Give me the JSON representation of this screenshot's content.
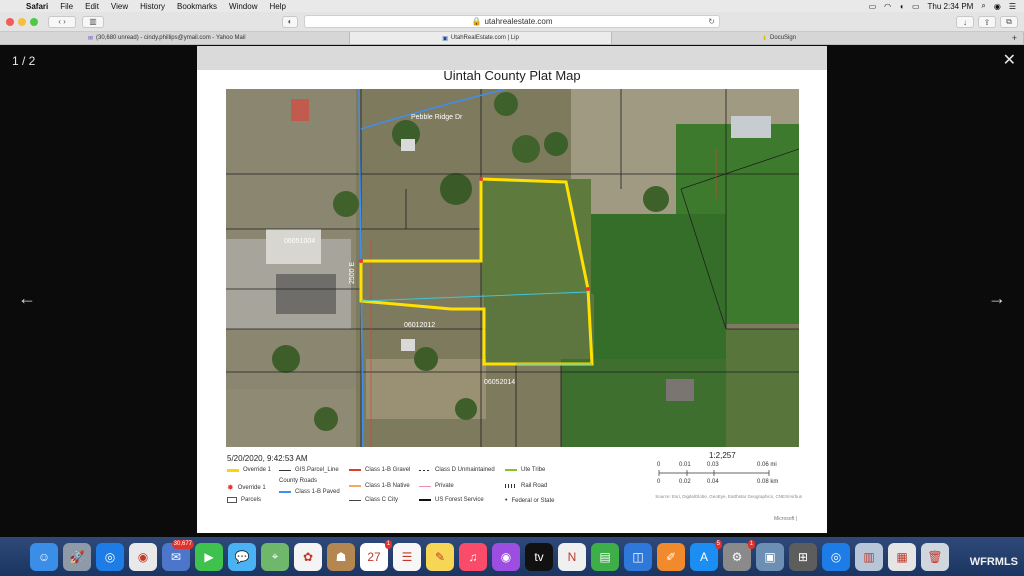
{
  "menubar": {
    "apple_icon": "apple-icon",
    "app_name": "Safari",
    "items": [
      "File",
      "Edit",
      "View",
      "History",
      "Bookmarks",
      "Window",
      "Help"
    ],
    "clock": "Thu 2:34 PM"
  },
  "browser": {
    "url": "utahrealestate.com",
    "tabs": [
      {
        "label": "(30,680 unread) - cindy.phillips@ymail.com - Yahoo Mail",
        "active": false
      },
      {
        "label": "UtahRealEstate.com | Lip",
        "active": true
      },
      {
        "label": "DocuSign",
        "active": false
      }
    ]
  },
  "lightbox": {
    "counter": "1 / 2",
    "close_icon": "close-icon",
    "prev_icon": "arrow-left-icon",
    "next_icon": "arrow-right-icon"
  },
  "plat": {
    "title": "Uintah County Plat Map",
    "timestamp": "5/20/2020, 9:42:53 AM",
    "scale_ratio": "1:2,257",
    "scale_mi": [
      "0",
      "0.01",
      "0.03",
      "0.06 mi"
    ],
    "scale_km": [
      "0",
      "0.02",
      "0.04",
      "0.08 km"
    ],
    "source": "Source: Esri, DigitalGlobe, GeoEye, Earthstar Geographics, CNES/Airbus",
    "microsoft": "Microsoft |",
    "map_labels": {
      "pebble_ridge": "Pebble Ridge Dr",
      "street_2500": "2500 E",
      "parcel_a": "06051004",
      "parcel_b": "06012012",
      "parcel_c": "06052014"
    },
    "legend": [
      {
        "label": "Override 1",
        "kind": "yellow-line",
        "color": "#ffd500"
      },
      {
        "label": "Override 1",
        "kind": "red-star",
        "color": "#e33"
      },
      {
        "label": "Parcels",
        "kind": "box",
        "color": "#555"
      },
      {
        "label": "GIS.Parcel_Line",
        "kind": "line",
        "color": "#333"
      },
      {
        "label": "County Roads",
        "kind": "none",
        "color": "#333"
      },
      {
        "label": "Class 1-B Paved",
        "kind": "line",
        "color": "#3f8ef0"
      },
      {
        "label": "Class 1-B Gravel",
        "kind": "line",
        "color": "#e23c2c"
      },
      {
        "label": "Class 1-B Native",
        "kind": "line",
        "color": "#f2a86a"
      },
      {
        "label": "Class C City",
        "kind": "line",
        "color": "#444"
      },
      {
        "label": "Class D Unmaintained",
        "kind": "dash",
        "color": "#333"
      },
      {
        "label": "Private",
        "kind": "line",
        "color": "#f08fb0"
      },
      {
        "label": "US Forest Service",
        "kind": "line",
        "color": "#111"
      },
      {
        "label": "Ute Tribe",
        "kind": "line",
        "color": "#7ec23c"
      },
      {
        "label": "Rail Road",
        "kind": "rail",
        "color": "#333"
      },
      {
        "label": "Federal or State",
        "kind": "dot",
        "color": "#333"
      }
    ]
  },
  "dock": {
    "apps": [
      {
        "name": "finder-icon",
        "color": "#3a8ee8",
        "glyph": "☺",
        "badge": ""
      },
      {
        "name": "launchpad-icon",
        "color": "#8e9aa8",
        "glyph": "🚀",
        "badge": ""
      },
      {
        "name": "safari-icon",
        "color": "#1e7ce6",
        "glyph": "◎",
        "badge": ""
      },
      {
        "name": "chrome-icon",
        "color": "#e9e9e9",
        "glyph": "◉",
        "badge": ""
      },
      {
        "name": "mail-icon",
        "color": "#4b76c9",
        "glyph": "✉",
        "badge": "30,677"
      },
      {
        "name": "facetime-icon",
        "color": "#3ec24d",
        "glyph": "▶",
        "badge": ""
      },
      {
        "name": "messages-icon",
        "color": "#4ab1f2",
        "glyph": "💬",
        "badge": ""
      },
      {
        "name": "maps-icon",
        "color": "#6fb76a",
        "glyph": "⌖",
        "badge": ""
      },
      {
        "name": "photos-icon",
        "color": "#f4f4f4",
        "glyph": "✿",
        "badge": ""
      },
      {
        "name": "contacts-icon",
        "color": "#b3874f",
        "glyph": "☗",
        "badge": ""
      },
      {
        "name": "calendar-icon",
        "color": "#ffffff",
        "glyph": "27",
        "badge": "1"
      },
      {
        "name": "reminders-icon",
        "color": "#f7f7f7",
        "glyph": "☰",
        "badge": ""
      },
      {
        "name": "notes-icon",
        "color": "#f7d655",
        "glyph": "✎",
        "badge": ""
      },
      {
        "name": "music-icon",
        "color": "#fa4b6b",
        "glyph": "♫",
        "badge": ""
      },
      {
        "name": "podcasts-icon",
        "color": "#9c4ee0",
        "glyph": "◉",
        "badge": ""
      },
      {
        "name": "appletv-icon",
        "color": "#111111",
        "glyph": "tv",
        "badge": ""
      },
      {
        "name": "news-icon",
        "color": "#f0f0f0",
        "glyph": "N",
        "badge": ""
      },
      {
        "name": "numbers-icon",
        "color": "#3dae48",
        "glyph": "▤",
        "badge": ""
      },
      {
        "name": "keynote-icon",
        "color": "#2d78d8",
        "glyph": "◫",
        "badge": ""
      },
      {
        "name": "pages-icon",
        "color": "#f18a2c",
        "glyph": "✐",
        "badge": ""
      },
      {
        "name": "appstore-icon",
        "color": "#1c8ef3",
        "glyph": "A",
        "badge": "5"
      },
      {
        "name": "system-preferences-icon",
        "color": "#8a8a8a",
        "glyph": "⚙",
        "badge": "1"
      },
      {
        "name": "preview-icon",
        "color": "#6d8fb3",
        "glyph": "▣",
        "badge": ""
      },
      {
        "name": "calculator-icon",
        "color": "#5d5d5d",
        "glyph": "⊞",
        "badge": ""
      },
      {
        "name": "safari-2-icon",
        "color": "#1e7ce6",
        "glyph": "◎",
        "badge": ""
      },
      {
        "name": "downloads-icon",
        "color": "#b7c6d8",
        "glyph": "▥",
        "badge": ""
      },
      {
        "name": "documents-icon",
        "color": "#e5e5e5",
        "glyph": "▦",
        "badge": ""
      },
      {
        "name": "trash-icon",
        "color": "#cfd6dd",
        "glyph": "🗑",
        "badge": ""
      }
    ]
  },
  "watermark": "WFRMLS"
}
